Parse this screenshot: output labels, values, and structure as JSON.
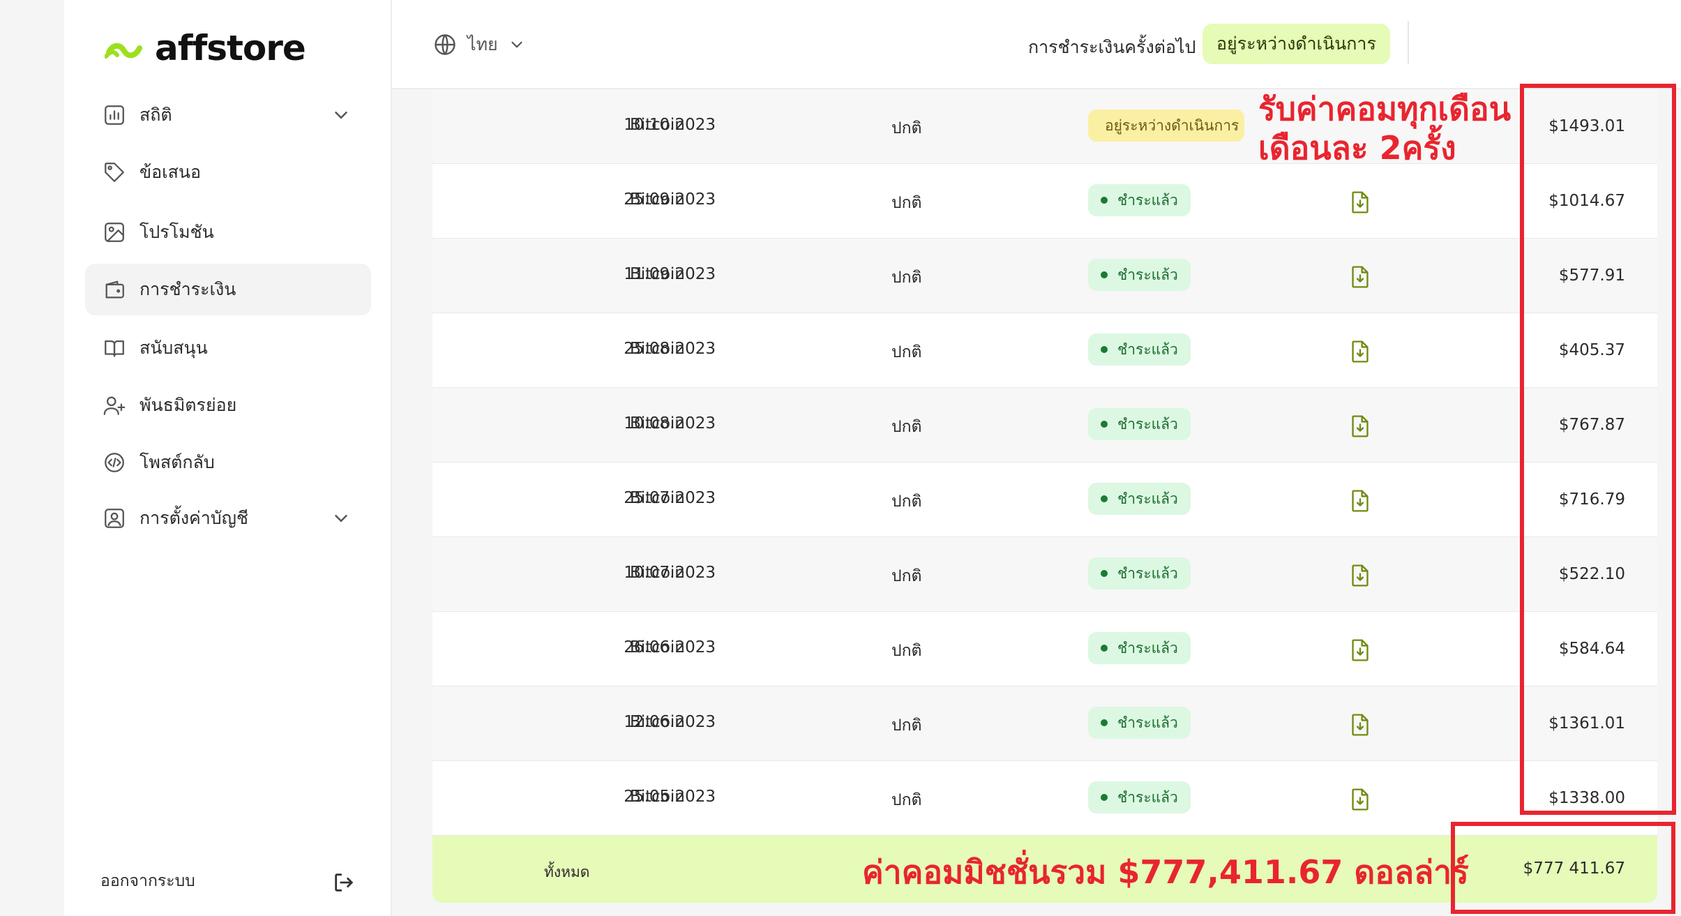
{
  "brand": {
    "name": "affstore",
    "accent": "#9be01e"
  },
  "sidebar": {
    "items": [
      {
        "label": "สถิติ",
        "icon": "bar-chart-icon",
        "has_chevron": true
      },
      {
        "label": "ข้อเสนอ",
        "icon": "tag-icon"
      },
      {
        "label": "โปรโมชัน",
        "icon": "image-icon"
      },
      {
        "label": "การชำระเงิน",
        "icon": "wallet-icon",
        "active": true
      },
      {
        "label": "สนับสนุน",
        "icon": "book-icon"
      },
      {
        "label": "พันธมิตรย่อย",
        "icon": "user-plus-icon"
      },
      {
        "label": "โพสต์กลับ",
        "icon": "code-icon"
      },
      {
        "label": "การตั้งค่าบัญชี",
        "icon": "user-card-icon",
        "has_chevron": true
      }
    ],
    "logout_label": "ออกจากระบบ"
  },
  "topbar": {
    "language": "ไทย",
    "next_payment_label": "การชำระเงินครั้งต่อไป",
    "next_payment_status": "อยู่ระหว่างดำเนินการ"
  },
  "payments": {
    "rows": [
      {
        "date": "10.10.2023",
        "method": "Bitcoin",
        "type": "ปกติ",
        "status": "อยู่ระหว่างดำเนินการ",
        "status_kind": "pending",
        "has_file": false,
        "amount": "$1493.01"
      },
      {
        "date": "25.09.2023",
        "method": "Bitcoin",
        "type": "ปกติ",
        "status": "ชำระแล้ว",
        "status_kind": "paid",
        "has_file": true,
        "amount": "$1014.67"
      },
      {
        "date": "11.09.2023",
        "method": "Bitcoin",
        "type": "ปกติ",
        "status": "ชำระแล้ว",
        "status_kind": "paid",
        "has_file": true,
        "amount": "$577.91"
      },
      {
        "date": "25.08.2023",
        "method": "Bitcoin",
        "type": "ปกติ",
        "status": "ชำระแล้ว",
        "status_kind": "paid",
        "has_file": true,
        "amount": "$405.37"
      },
      {
        "date": "10.08.2023",
        "method": "Bitcoin",
        "type": "ปกติ",
        "status": "ชำระแล้ว",
        "status_kind": "paid",
        "has_file": true,
        "amount": "$767.87"
      },
      {
        "date": "25.07.2023",
        "method": "Bitcoin",
        "type": "ปกติ",
        "status": "ชำระแล้ว",
        "status_kind": "paid",
        "has_file": true,
        "amount": "$716.79"
      },
      {
        "date": "10.07.2023",
        "method": "Bitcoin",
        "type": "ปกติ",
        "status": "ชำระแล้ว",
        "status_kind": "paid",
        "has_file": true,
        "amount": "$522.10"
      },
      {
        "date": "26.06.2023",
        "method": "Bitcoin",
        "type": "ปกติ",
        "status": "ชำระแล้ว",
        "status_kind": "paid",
        "has_file": true,
        "amount": "$584.64"
      },
      {
        "date": "12.06.2023",
        "method": "Bitcoin",
        "type": "ปกติ",
        "status": "ชำระแล้ว",
        "status_kind": "paid",
        "has_file": true,
        "amount": "$1361.01"
      },
      {
        "date": "25.05.2023",
        "method": "Bitcoin",
        "type": "ปกติ",
        "status": "ชำระแล้ว",
        "status_kind": "paid",
        "has_file": true,
        "amount": "$1338.00"
      }
    ],
    "total_label": "ทั้งหมด",
    "total_amount": "$777 411.67"
  },
  "annotations": {
    "top_note_line1": "รับค่าคอมทุกเดือน",
    "top_note_line2": "เดือนละ 2ครั้ง",
    "bottom_note": "ค่าคอมมิชชั่นรวม $777,411.67 ดอลล่าร์",
    "color": "#e8252f"
  }
}
